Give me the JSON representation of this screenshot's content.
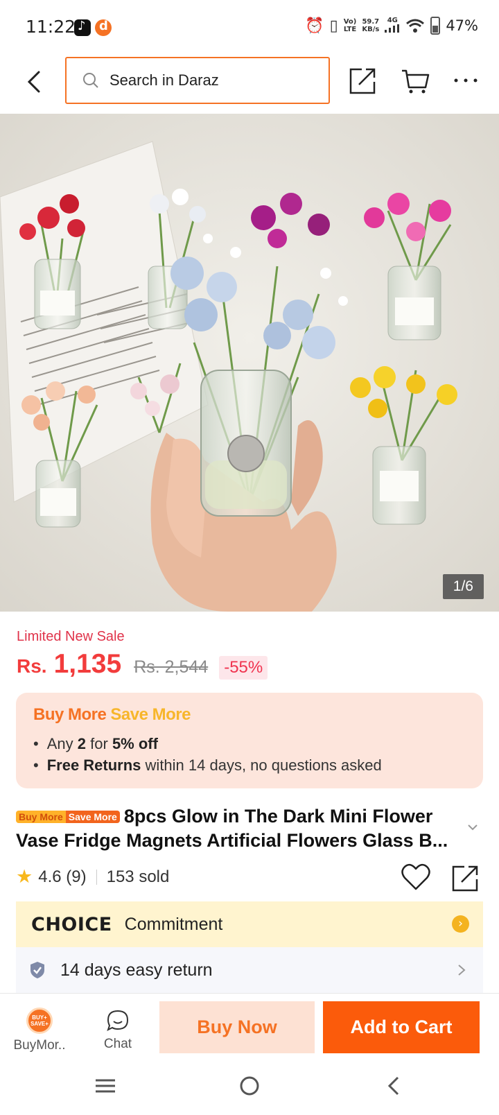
{
  "status_bar": {
    "time": "11:22",
    "net_top": "59.7",
    "net_bottom": "KB/s",
    "volte_top": "Vo)",
    "volte_bottom": "LTE",
    "signal_label": "4G",
    "battery": "47%"
  },
  "header": {
    "search_placeholder": "Search in Daraz"
  },
  "gallery": {
    "counter": "1/6"
  },
  "price": {
    "sale_label": "Limited New Sale",
    "currency": "Rs.",
    "current": "1,135",
    "original": "Rs. 2,544",
    "discount": "-55%"
  },
  "promo": {
    "title_part1": "Buy More",
    "title_part2": "Save More",
    "line1_prefix": "Any",
    "line1_qty": "2",
    "line1_for": "for",
    "line1_off": "5% off",
    "line2_bold": "Free Returns",
    "line2_rest": "within 14 days, no questions asked"
  },
  "product": {
    "tag_part1": "Buy More",
    "tag_part2": "Save More",
    "title": "8pcs Glow in The Dark Mini Flower Vase Fridge Magnets Artificial Flowers Glass B...",
    "rating": "4.6",
    "reviews": "(9)",
    "sold": "153 sold"
  },
  "choice": {
    "logo": "CHOICE",
    "label": "Commitment"
  },
  "returns": {
    "label": "14 days easy return"
  },
  "bottom_bar": {
    "buymore_label": "BuyMor..",
    "buymore_icon_text": "BUY+ SAVE+",
    "chat_label": "Chat",
    "buy_now": "Buy Now",
    "add_to_cart": "Add to Cart"
  },
  "colors": {
    "accent": "#f57224",
    "price_red": "#f23c3c",
    "add_to_cart_bg": "#fb5b0b",
    "buy_now_bg": "#fde1d3",
    "promo_bg": "#fde5dc",
    "choice_bg": "#fff4cf"
  },
  "icons": {
    "back": "chevron-left-icon",
    "search": "search-icon",
    "share": "share-icon",
    "cart": "cart-icon",
    "more": "more-dots-icon",
    "star": "star-icon",
    "heart": "heart-icon",
    "shield": "shield-icon",
    "chat": "chat-bubble-icon"
  }
}
